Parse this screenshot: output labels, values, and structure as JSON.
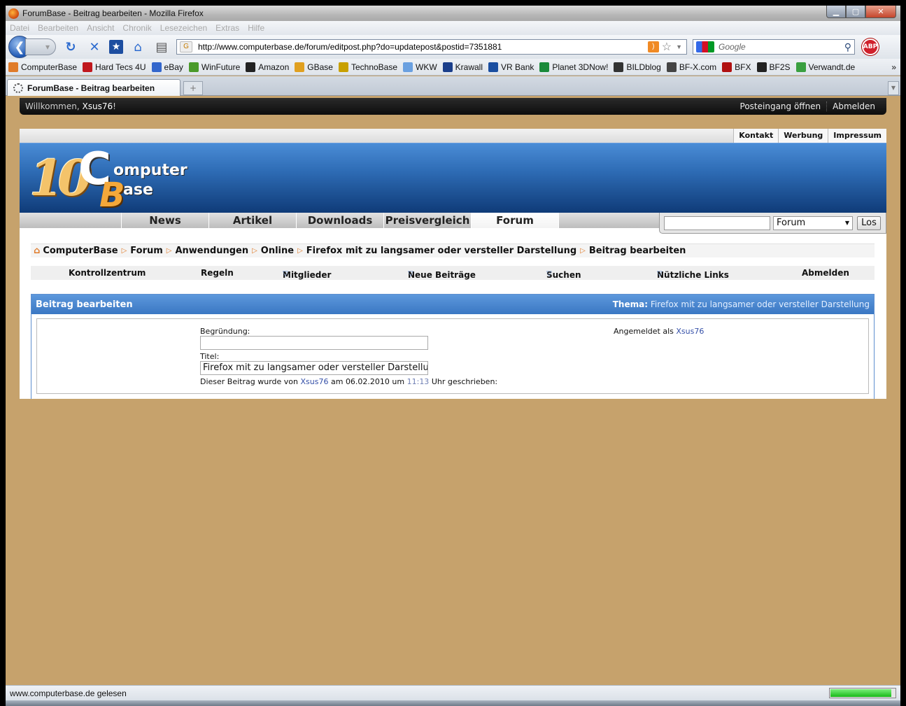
{
  "window": {
    "title": "ForumBase - Beitrag bearbeiten - Mozilla Firefox"
  },
  "menu": [
    "Datei",
    "Bearbeiten",
    "Ansicht",
    "Chronik",
    "Lesezeichen",
    "Extras",
    "Hilfe"
  ],
  "toolbar": {
    "url": "http://www.computerbase.de/forum/editpost.php?do=updatepost&postid=7351881",
    "search_placeholder": "Google",
    "abp_label": "ABP"
  },
  "bookmarks": [
    {
      "label": "ComputerBase",
      "color": "#e07b2a"
    },
    {
      "label": "Hard Tecs 4U",
      "color": "#c0181e"
    },
    {
      "label": "eBay",
      "color": "#3366cc"
    },
    {
      "label": "WinFuture",
      "color": "#4a9a2a"
    },
    {
      "label": "Amazon",
      "color": "#222222"
    },
    {
      "label": "GBase",
      "color": "#e0a020"
    },
    {
      "label": "TechnoBase",
      "color": "#c8a000"
    },
    {
      "label": "WKW",
      "color": "#6aa0e0"
    },
    {
      "label": "Krawall",
      "color": "#1a3e8a"
    },
    {
      "label": "VR Bank",
      "color": "#1a4ea0"
    },
    {
      "label": "Planet 3DNow!",
      "color": "#1a8a3a"
    },
    {
      "label": "BILDblog",
      "color": "#333333"
    },
    {
      "label": "BF-X.com",
      "color": "#444444"
    },
    {
      "label": "BFX",
      "color": "#b01010"
    },
    {
      "label": "BF2S",
      "color": "#222222"
    },
    {
      "label": "Verwandt.de",
      "color": "#3aa040"
    }
  ],
  "bookmarks_more": "»",
  "tab": {
    "title": "ForumBase - Beitrag bearbeiten",
    "new_tab": "+"
  },
  "welcome": {
    "prefix": "Willkommen,",
    "user": "Xsus76",
    "suffix": "!",
    "inbox": "Posteingang öffnen",
    "logout": "Abmelden"
  },
  "toplinks": [
    "Kontakt",
    "Werbung",
    "Impressum"
  ],
  "logo": {
    "ten": "10",
    "c": "C",
    "omputer": "omputer",
    "b": "B",
    "ase": "ase"
  },
  "mainnav": [
    "News",
    "Artikel",
    "Downloads",
    "Preisvergleich",
    "Forum"
  ],
  "site_search": {
    "scope": "Forum",
    "button": "Los"
  },
  "breadcrumb": [
    "ComputerBase",
    "Forum",
    "Anwendungen",
    "Online",
    "Firefox mit zu langsamer oder versteller Darstellung",
    "Beitrag bearbeiten"
  ],
  "subnav": {
    "control": "Kontrollzentrum",
    "rules": "Regeln",
    "members": "Mitglieder",
    "new_posts": "Neue Beiträge",
    "search": "Suchen",
    "links": "Nützliche Links",
    "logout": "Abmelden"
  },
  "panel": {
    "title": "Beitrag bearbeiten",
    "thema_label": "Thema:",
    "thema_value": "Firefox mit zu langsamer oder versteller Darstellung",
    "reason_label": "Begründung:",
    "reason_value": "",
    "title_label": "Titel:",
    "title_value": "Firefox mit zu langsamer oder versteller Darstellung",
    "logged_in_prefix": "Angemeldet als",
    "logged_in_user": "Xsus76",
    "written_prefix": "Dieser Beitrag wurde von",
    "written_user": "Xsus76",
    "written_am": "am",
    "written_date": "06.02.2010",
    "written_um": "um",
    "written_time": "11:13",
    "written_suffix": "Uhr geschrieben:"
  },
  "status": {
    "text": "www.computerbase.de gelesen",
    "progress": 0.95
  }
}
